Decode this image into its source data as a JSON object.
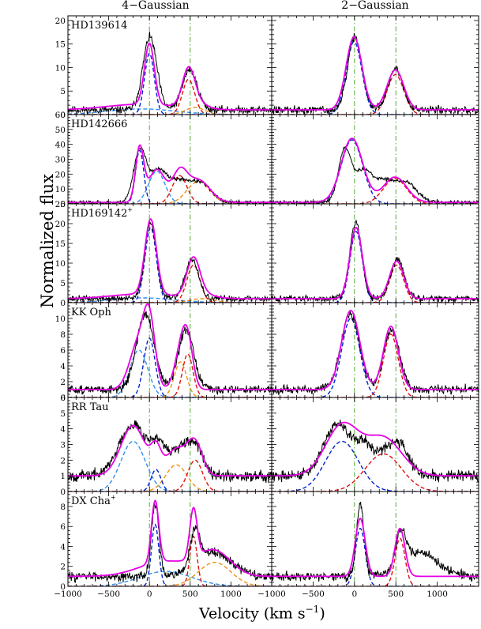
{
  "figure": {
    "column_titles": [
      "4−Gaussian",
      "2−Gaussian"
    ],
    "ylabel": "Normalized flux",
    "xlabel_main": "Velocity (km s",
    "xlabel_sup": "−1",
    "xlabel_end": ")"
  },
  "chart_data": {
    "type": "line",
    "layout": "6 rows x 2 columns of panels sharing x axis",
    "xlim": [
      -1000,
      1500
    ],
    "x_ticks": [
      -1000,
      -500,
      0,
      500,
      1000
    ],
    "x_tick_labels": [
      "−1000",
      "−500",
      "0",
      "500",
      "1000"
    ],
    "reference_lines": [
      0,
      500
    ],
    "colors": {
      "observed": "#000000",
      "total_fit": "#e600e6",
      "blue_component": "#0022cc",
      "light_blue_component": "#2f8ff0",
      "red_component": "#e01010",
      "orange_component": "#f09010",
      "reference": "#55aa33"
    },
    "panels": [
      {
        "label": "HD139614",
        "sup": "",
        "ylim": [
          0,
          21
        ],
        "yticks": [
          0,
          5,
          10,
          15,
          20
        ],
        "baseline": 1,
        "four": {
          "blue": [
            [
              0,
              13,
              60
            ]
          ],
          "lightblue": [
            [
              -100,
              1.2,
              420
            ]
          ],
          "red": [
            [
              480,
              7.5,
              75
            ]
          ],
          "orange": [
            [
              560,
              1.5,
              120
            ]
          ]
        },
        "two": {
          "blue": [
            [
              -5,
              15.5,
              95
            ]
          ],
          "red": [
            [
              495,
              8.5,
              100
            ]
          ]
        },
        "obs": {
          "comps": [
            [
              5,
              15.5,
              85
            ],
            [
              495,
              8.5,
              90
            ]
          ],
          "noise": 0.8,
          "seed": 11
        }
      },
      {
        "label": "HD142666",
        "sup": "",
        "ylim": [
          0,
          60
        ],
        "yticks": [
          0,
          10,
          20,
          30,
          40,
          50,
          60
        ],
        "baseline": 1,
        "four": {
          "blue": [
            [
              -120,
              36,
              50
            ]
          ],
          "lightblue": [
            [
              90,
              22,
              100
            ]
          ],
          "red": [
            [
              370,
              19,
              90
            ]
          ],
          "orange": [
            [
              600,
              15,
              140
            ]
          ]
        },
        "two": {
          "blue": [
            [
              -30,
              43,
              130
            ]
          ],
          "red": [
            [
              490,
              17,
              140
            ]
          ]
        },
        "obs": {
          "comps": [
            [
              -120,
              34,
              75
            ],
            [
              100,
              20,
              110
            ],
            [
              380,
              14,
              140
            ],
            [
              650,
              11,
              120
            ]
          ],
          "noise": 1.2,
          "seed": 23
        }
      },
      {
        "label": "HD169142",
        "sup": "+",
        "ylim": [
          0,
          25
        ],
        "yticks": [
          0,
          5,
          10,
          15,
          20,
          25
        ],
        "baseline": 1,
        "four": {
          "blue": [
            [
              15,
              19,
              70
            ]
          ],
          "lightblue": [
            [
              -80,
              1.2,
              380
            ]
          ],
          "red": [
            [
              540,
              9.5,
              80
            ]
          ],
          "orange": [
            [
              650,
              1,
              150
            ]
          ]
        },
        "two": {
          "blue": [
            [
              20,
              18,
              75
            ]
          ],
          "red": [
            [
              510,
              9.5,
              85
            ]
          ]
        },
        "obs": {
          "comps": [
            [
              15,
              19.5,
              70
            ],
            [
              520,
              10,
              80
            ]
          ],
          "noise": 0.8,
          "seed": 37
        }
      },
      {
        "label": "KK Oph",
        "sup": "",
        "ylim": [
          0,
          12
        ],
        "yticks": [
          0,
          2,
          4,
          6,
          8,
          10
        ],
        "baseline": 1,
        "four": {
          "blue": [
            [
              0,
              7.5,
              70
            ]
          ],
          "lightblue": [
            [
              -130,
              6,
              110
            ]
          ],
          "red": [
            [
              470,
              5.5,
              65
            ]
          ],
          "orange": [
            [
              380,
              4.5,
              75
            ]
          ]
        },
        "two": {
          "blue": [
            [
              -45,
              10,
              110
            ]
          ],
          "red": [
            [
              440,
              8,
              90
            ]
          ]
        },
        "obs": {
          "comps": [
            [
              -50,
              9.5,
              110
            ],
            [
              450,
              7.5,
              95
            ]
          ],
          "noise": 0.55,
          "seed": 51
        }
      },
      {
        "label": "RR Tau",
        "sup": "",
        "ylim": [
          0,
          6
        ],
        "yticks": [
          0,
          1,
          2,
          3,
          4,
          5,
          6
        ],
        "baseline": 1,
        "four": {
          "blue": [
            [
              80,
              1.4,
              60
            ]
          ],
          "lightblue": [
            [
              -200,
              3.2,
              150
            ]
          ],
          "red": [
            [
              560,
              2,
              90
            ]
          ],
          "orange": [
            [
              330,
              1.7,
              130
            ]
          ]
        },
        "two": {
          "blue": [
            [
              -150,
              3.2,
              200
            ]
          ],
          "red": [
            [
              350,
              2.4,
              220
            ]
          ]
        },
        "obs": {
          "comps": [
            [
              -200,
              3.3,
              170
            ],
            [
              100,
              1.2,
              80
            ],
            [
              330,
              1.5,
              150
            ],
            [
              560,
              1.6,
              110
            ]
          ],
          "noise": 0.35,
          "seed": 67
        }
      },
      {
        "label": "DX Cha",
        "sup": "+",
        "ylim": [
          0,
          9.5
        ],
        "yticks": [
          0,
          2,
          4,
          6,
          8
        ],
        "baseline": 1,
        "four": {
          "blue": [
            [
              70,
              6.2,
              45
            ]
          ],
          "lightblue": [
            [
              200,
              1.5,
              320
            ]
          ],
          "red": [
            [
              540,
              5,
              45
            ]
          ],
          "orange": [
            [
              800,
              2.4,
              200
            ]
          ]
        },
        "two": {
          "blue": [
            [
              70,
              5.8,
              60
            ]
          ],
          "red": [
            [
              550,
              4.8,
              60
            ]
          ]
        },
        "obs": {
          "comps": [
            [
              70,
              7.3,
              45
            ],
            [
              560,
              3.4,
              55
            ],
            [
              780,
              2.4,
              220
            ]
          ],
          "noise": 0.45,
          "seed": 83
        }
      }
    ]
  }
}
